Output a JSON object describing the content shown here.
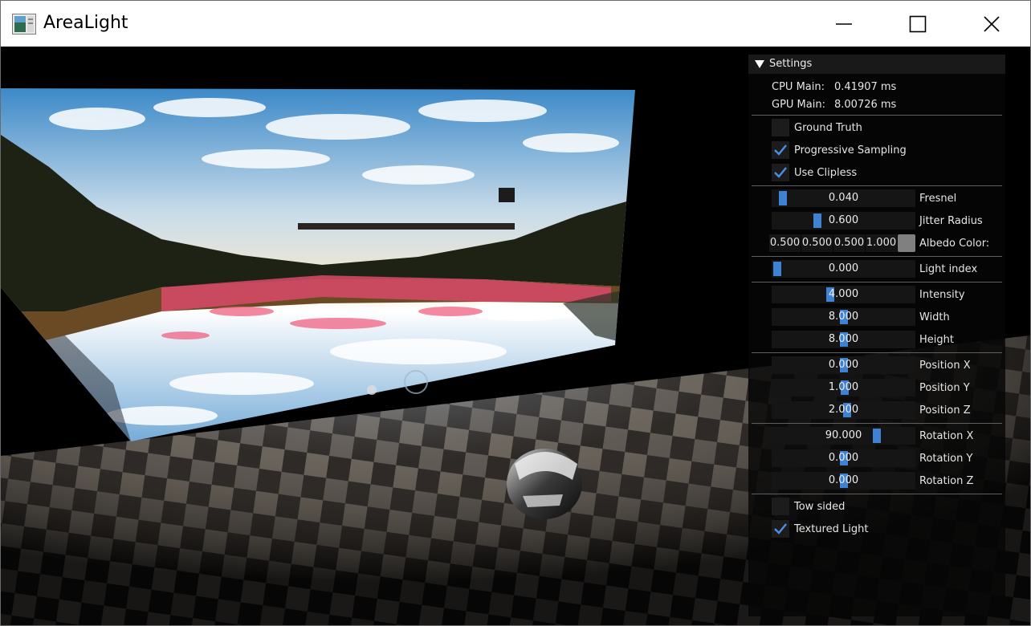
{
  "window": {
    "title": "AreaLight",
    "controls": {
      "minimize": "minimize-icon",
      "maximize": "maximize-icon",
      "close": "close-icon"
    }
  },
  "settings": {
    "header": "Settings",
    "stats": [
      {
        "label": "CPU Main:",
        "value": "0.41907 ms"
      },
      {
        "label": "GPU Main:",
        "value": "8.00726 ms"
      }
    ],
    "checkboxes_top": [
      {
        "label": "Ground Truth",
        "checked": false
      },
      {
        "label": "Progressive Sampling",
        "checked": true
      },
      {
        "label": "Use Clipless",
        "checked": true
      }
    ],
    "fresnel": {
      "label": "Fresnel",
      "value": "0.040",
      "level": 0.04
    },
    "jitter": {
      "label": "Jitter Radius",
      "value": "0.600",
      "level": 0.3
    },
    "albedo": {
      "label": "Albedo Color:",
      "r": "0.500",
      "g": "0.500",
      "b": "0.500",
      "a": "1.000",
      "swatch": "#808080"
    },
    "light_index": {
      "label": "Light index",
      "value": "0.000",
      "level": 0.0
    },
    "light": [
      {
        "label": "Intensity",
        "value": "4.000",
        "level": 0.4
      },
      {
        "label": "Width",
        "value": "8.000",
        "level": 0.5
      },
      {
        "label": "Height",
        "value": "8.000",
        "level": 0.5
      }
    ],
    "position": [
      {
        "label": "Position X",
        "value": "0.000",
        "level": 0.5
      },
      {
        "label": "Position Y",
        "value": "1.000",
        "level": 0.51
      },
      {
        "label": "Position Z",
        "value": "2.000",
        "level": 0.53
      }
    ],
    "rotation": [
      {
        "label": "Rotation X",
        "value": "90.000",
        "level": 0.75
      },
      {
        "label": "Rotation Y",
        "value": "0.000",
        "level": 0.5
      },
      {
        "label": "Rotation Z",
        "value": "0.000",
        "level": 0.5
      }
    ],
    "checkboxes_bottom": [
      {
        "label": "Tow sided",
        "checked": false
      },
      {
        "label": "Textured Light",
        "checked": true
      }
    ]
  },
  "colors": {
    "accent": "#3f82d3",
    "check": "#4a90e8",
    "panel_bg": "#060606",
    "frame_bg": "#151515"
  }
}
